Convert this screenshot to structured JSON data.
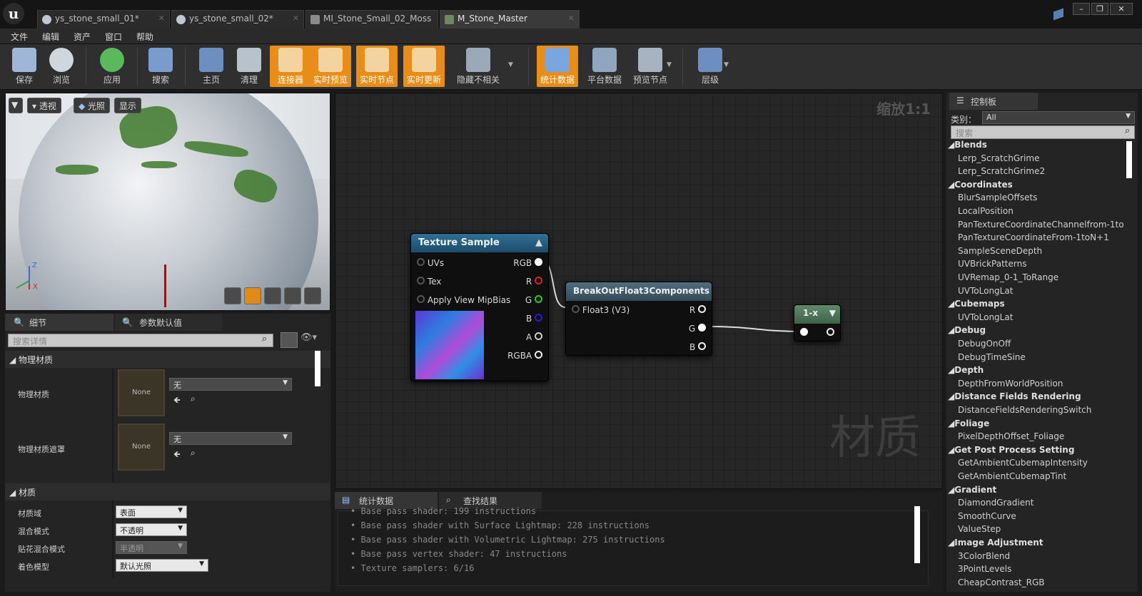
{
  "tabs": [
    "ys_stone_small_01*",
    "ys_stone_small_02*",
    "MI_Stone_Small_02_Moss",
    "M_Stone_Master"
  ],
  "window_buttons": [
    "–",
    "❐",
    "✕"
  ],
  "menu": [
    "文件",
    "编辑",
    "资产",
    "窗口",
    "帮助"
  ],
  "toolbar": {
    "save": "保存",
    "browse": "浏览",
    "apply": "应用",
    "search": "搜索",
    "home": "主页",
    "clean": "清理",
    "connectors": "连接器",
    "live_preview": "实时预览",
    "live_nodes": "实时节点",
    "live_update": "实时更新",
    "hide_unrelated": "隐藏不相关",
    "stats": "统计数据",
    "platform_stats": "平台数据",
    "preview_node": "预览节点",
    "hierarchy": "层级"
  },
  "viewport": {
    "perspective": "透视",
    "lit": "光照",
    "show": "显示"
  },
  "details": {
    "tab1": "细节",
    "tab2": "参数默认值",
    "search_placeholder": "搜索详情",
    "cat_phys": "物理材质",
    "phys_mat": "物理材质",
    "phys_mask": "物理材质遮罩",
    "none": "None",
    "none_cn": "无",
    "cat_mat": "材质",
    "domain_label": "材质域",
    "domain_val": "表面",
    "blend_label": "混合模式",
    "blend_val": "不透明",
    "decal_label": "贴花混合模式",
    "decal_val": "半透明",
    "shading_label": "着色模型",
    "shading_val": "默认光照"
  },
  "graph": {
    "zoom": "缩放1:1",
    "watermark": "材质",
    "tex": {
      "title": "Texture Sample",
      "in": [
        "UVs",
        "Tex",
        "Apply View MipBias"
      ],
      "out": [
        "RGB",
        "R",
        "G",
        "B",
        "A",
        "RGBA"
      ]
    },
    "breakout": {
      "title": "BreakOutFloat3Components",
      "in": "Float3 (V3)",
      "out": [
        "R",
        "G",
        "B"
      ]
    },
    "oneminus": {
      "title": "1-x"
    }
  },
  "stats": {
    "tab1": "统计数据",
    "tab2": "查找结果",
    "lines": [
      "Base pass shader: 199 instructions",
      "Base pass shader with Surface Lightmap: 228 instructions",
      "Base pass shader with Volumetric Lightmap: 275 instructions",
      "Base pass vertex shader: 47 instructions",
      "Texture samplers: 6/16"
    ]
  },
  "palette": {
    "tab": "控制板",
    "category_label": "类别：",
    "category_val": "All",
    "search_placeholder": "搜索",
    "items": [
      {
        "cat": "Blends"
      },
      {
        "item": "Lerp_ScratchGrime"
      },
      {
        "item": "Lerp_ScratchGrime2"
      },
      {
        "cat": "Coordinates"
      },
      {
        "item": "BlurSampleOffsets"
      },
      {
        "item": "LocalPosition"
      },
      {
        "item": "PanTextureCoordinateChannelfrom-1to"
      },
      {
        "item": "PanTextureCoordinateFrom-1toN+1"
      },
      {
        "item": "SampleSceneDepth"
      },
      {
        "item": "UVBrickPatterns"
      },
      {
        "item": "UVRemap_0-1_ToRange"
      },
      {
        "item": "UVToLongLat"
      },
      {
        "cat": "Cubemaps"
      },
      {
        "item": "UVToLongLat"
      },
      {
        "cat": "Debug"
      },
      {
        "item": "DebugOnOff"
      },
      {
        "item": "DebugTimeSine"
      },
      {
        "cat": "Depth"
      },
      {
        "item": "DepthFromWorldPosition"
      },
      {
        "cat": "Distance Fields Rendering"
      },
      {
        "item": "DistanceFieldsRenderingSwitch"
      },
      {
        "cat": "Foliage"
      },
      {
        "item": "PixelDepthOffset_Foliage"
      },
      {
        "cat": "Get Post Process Setting"
      },
      {
        "item": "GetAmbientCubemapIntensity"
      },
      {
        "item": "GetAmbientCubemapTint"
      },
      {
        "cat": "Gradient"
      },
      {
        "item": "DiamondGradient"
      },
      {
        "item": "SmoothCurve"
      },
      {
        "item": "ValueStep"
      },
      {
        "cat": "Image Adjustment"
      },
      {
        "item": "3ColorBlend"
      },
      {
        "item": "3PointLevels"
      },
      {
        "item": "CheapContrast_RGB"
      }
    ]
  }
}
